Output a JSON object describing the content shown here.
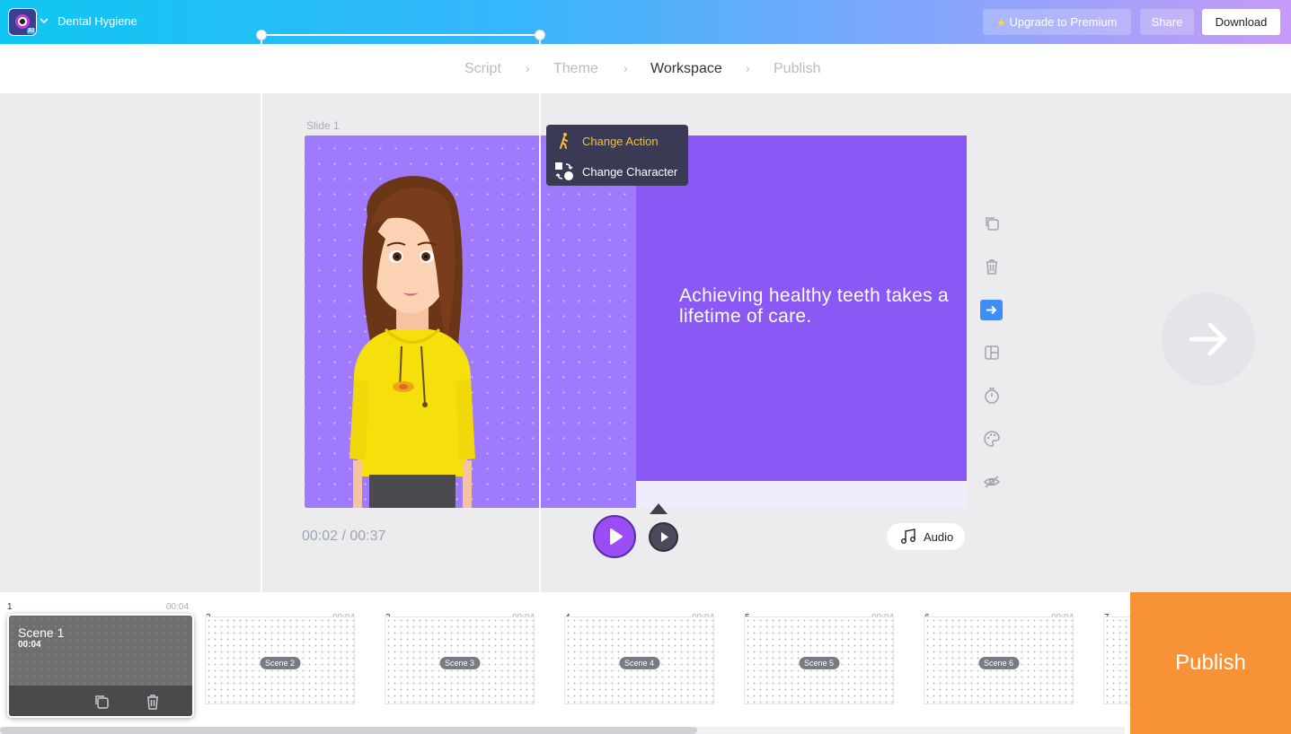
{
  "app": {
    "document_title": "Dental Hygiene",
    "logo_badge": "AI",
    "upgrade_label": "Upgrade to Premium",
    "share_label": "Share",
    "download_label": "Download"
  },
  "steps": [
    {
      "label": "Script",
      "active": false
    },
    {
      "label": "Theme",
      "active": false
    },
    {
      "label": "Workspace",
      "active": true
    },
    {
      "label": "Publish",
      "active": false
    }
  ],
  "slide": {
    "label": "Slide 1",
    "text": "Achieving healthy teeth takes a lifetime of care."
  },
  "context_menu": {
    "items": [
      {
        "label": "Change Action",
        "icon": "walking-person-icon",
        "color": "#f7c22b"
      },
      {
        "label": "Change Character",
        "icon": "swap-character-icon",
        "color": "#ffffff"
      }
    ]
  },
  "tools": [
    {
      "name": "duplicate-icon"
    },
    {
      "name": "trash-icon"
    },
    {
      "name": "transition-arrow-icon",
      "active": true
    },
    {
      "name": "layout-icon"
    },
    {
      "name": "timer-icon"
    },
    {
      "name": "palette-icon"
    },
    {
      "name": "hide-eye-icon"
    }
  ],
  "playback": {
    "timecode": "00:02 / 00:37",
    "audio_label": "Audio"
  },
  "timeline": {
    "active_scene": {
      "number": "1",
      "duration": "00:04",
      "title": "Scene 1",
      "sub_duration": "00:04"
    },
    "scenes": [
      {
        "number": "2",
        "duration": "00:04",
        "label": "Scene 2"
      },
      {
        "number": "3",
        "duration": "00:04",
        "label": "Scene 3"
      },
      {
        "number": "4",
        "duration": "00:04",
        "label": "Scene 4"
      },
      {
        "number": "5",
        "duration": "00:04",
        "label": "Scene 5"
      },
      {
        "number": "6",
        "duration": "00:04",
        "label": "Scene 6"
      },
      {
        "number": "7",
        "duration": "",
        "label": ""
      }
    ],
    "publish_label": "Publish"
  },
  "colors": {
    "accent_purple": "#9b4df5",
    "slide_bg": "#8a58f4",
    "publish_orange": "#f79336",
    "active_tool": "#3d8ef8"
  }
}
